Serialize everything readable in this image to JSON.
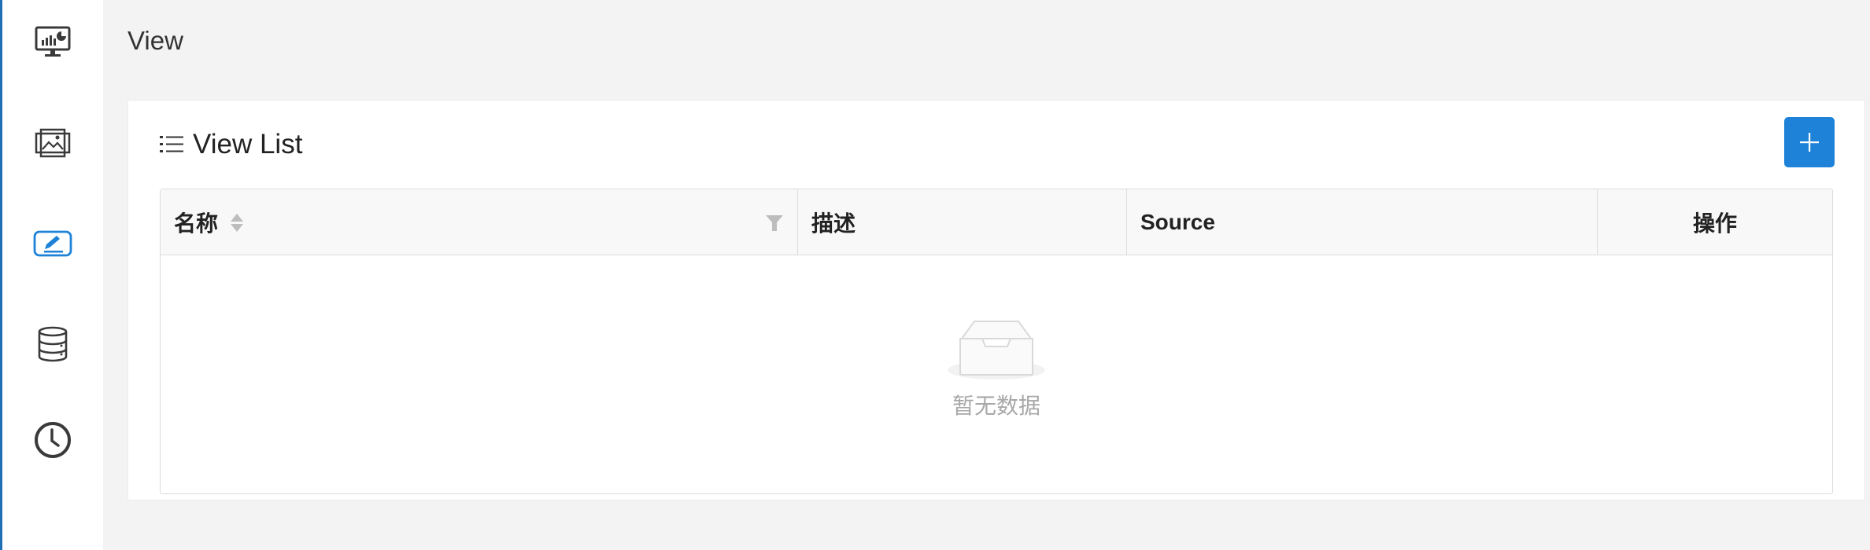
{
  "sidebar": {
    "items": [
      {
        "icon": "dashboard-monitor-icon",
        "active": false
      },
      {
        "icon": "widget-image-icon",
        "active": false
      },
      {
        "icon": "view-edit-icon",
        "active": true
      },
      {
        "icon": "database-icon",
        "active": false
      },
      {
        "icon": "schedule-clock-icon",
        "active": false
      }
    ]
  },
  "page": {
    "title": "View"
  },
  "card": {
    "title": "View List",
    "add_button_icon": "plus-icon"
  },
  "table": {
    "columns": [
      {
        "label": "名称",
        "sortable": true,
        "filterable": true
      },
      {
        "label": "描述"
      },
      {
        "label": "Source"
      },
      {
        "label": "操作"
      }
    ],
    "rows": [],
    "empty_text": "暂无数据"
  },
  "colors": {
    "accent": "#1e82d8",
    "active_nav": "#1e82d8",
    "icon": "#3a3a3a",
    "empty_text": "#a8a8a8"
  }
}
